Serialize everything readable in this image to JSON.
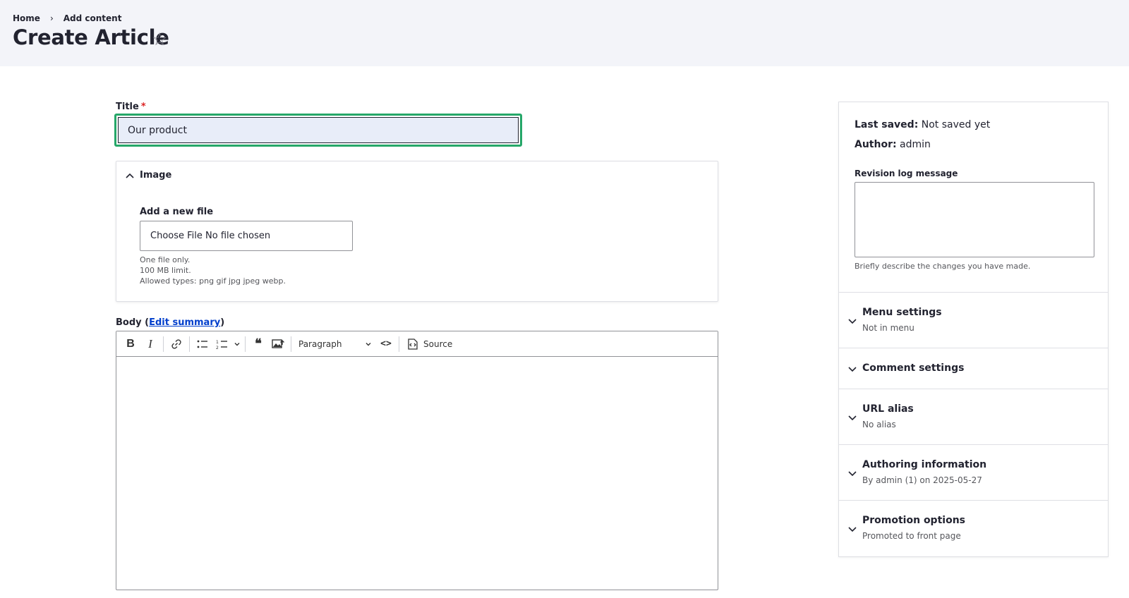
{
  "header": {
    "breadcrumb": [
      "Home",
      "Add content"
    ],
    "breadcrumb_sep": "›",
    "title": "Create Article",
    "star_glyph": "☆"
  },
  "form": {
    "title_label": "Title",
    "required_mark": "*",
    "title_value": "Our product",
    "image": {
      "summary": "Image",
      "file_label": "Add a new file",
      "file_button": "Choose File",
      "file_status": "No file chosen",
      "desc": [
        "One file only.",
        "100 MB limit.",
        "Allowed types: png gif jpg jpeg webp."
      ]
    },
    "body": {
      "label": "Body",
      "edit_summary": "Edit summary",
      "paragraph": "Paragraph",
      "source": "Source"
    }
  },
  "sidebar": {
    "last_saved_label": "Last saved:",
    "last_saved_value": "Not saved yet",
    "author_label": "Author:",
    "author_value": "admin",
    "revision_label": "Revision log message",
    "revision_desc": "Briefly describe the changes you have made.",
    "sections": [
      {
        "title": "Menu settings",
        "sub": "Not in menu"
      },
      {
        "title": "Comment settings",
        "sub": ""
      },
      {
        "title": "URL alias",
        "sub": "No alias"
      },
      {
        "title": "Authoring information",
        "sub": "By admin (1) on 2025-05-27"
      },
      {
        "title": "Promotion options",
        "sub": "Promoted to front page"
      }
    ]
  },
  "colors": {
    "header_bg": "#f3f4f9",
    "focus_green": "#26a769",
    "link_blue": "#003ecc",
    "required_red": "#dc2323"
  },
  "icons": [
    "star-icon",
    "chevron-up-icon",
    "chevron-down-icon",
    "bold-icon",
    "italic-icon",
    "link-icon",
    "bulleted-list-icon",
    "numbered-list-icon",
    "blockquote-icon",
    "image-upload-icon",
    "code-icon",
    "source-icon"
  ]
}
